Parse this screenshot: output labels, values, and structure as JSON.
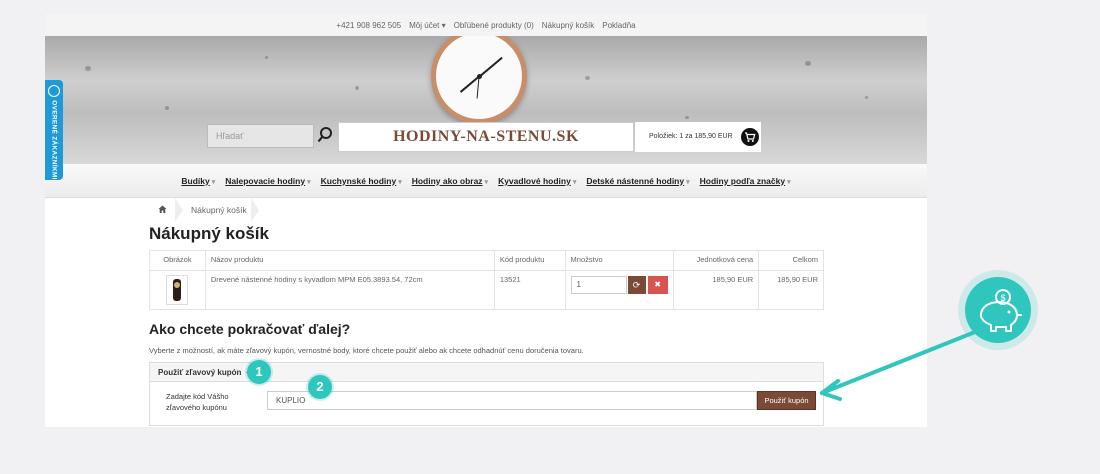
{
  "topbar": {
    "phone": "+421 908 962 505",
    "account": "Môj účet",
    "favorites": "Obľúbené produkty (0)",
    "cart": "Nákupný košík",
    "checkout": "Pokladňa"
  },
  "header": {
    "search_placeholder": "Hľadať",
    "logo": "HODINY-NA-STENU.SK",
    "cart_summary": "Položiek: 1 za 185,90 EUR"
  },
  "nav": [
    "Budíky",
    "Nalepovacie hodiny",
    "Kuchynské hodiny",
    "Hodiny ako obraz",
    "Kyvadlové hodiny",
    "Detské nástenné hodiny",
    "Hodiny podľa značky"
  ],
  "breadcrumb": {
    "current": "Nákupný košík"
  },
  "side_tab": {
    "label": "OVERENÉ ZÁKAZNÍKMI"
  },
  "cart": {
    "title": "Nákupný košík",
    "columns": [
      "Obrázok",
      "Názov produktu",
      "Kód produktu",
      "Množstvo",
      "Jednotková cena",
      "Celkom"
    ],
    "rows": [
      {
        "name": "Drevené nástenné hodiny s kyvadlom MPM E05.3893.54, 72cm",
        "code": "13521",
        "quantity": "1",
        "unit_price": "185,90 EUR",
        "total": "185,90 EUR"
      }
    ]
  },
  "next": {
    "title": "Ako chcete pokračovať ďalej?",
    "description": "Vyberte z možností, ak máte zľavový kupón, vernostné body, ktoré chcete použiť alebo ak chcete odhadnúť cenu doručenia tovaru.",
    "coupon_toggle": "Použiť zľavový kupón",
    "coupon_label": "Zadajte kód Vášho zľavového kupónu",
    "coupon_value": "KUPLIO",
    "coupon_button": "Použiť kupón"
  },
  "annotations": {
    "step1": "1",
    "step2": "2"
  },
  "colors": {
    "accent": "#7a4a36",
    "teal": "#2fc6bd",
    "danger": "#d9534f",
    "badge_blue": "#1f9ad6"
  }
}
